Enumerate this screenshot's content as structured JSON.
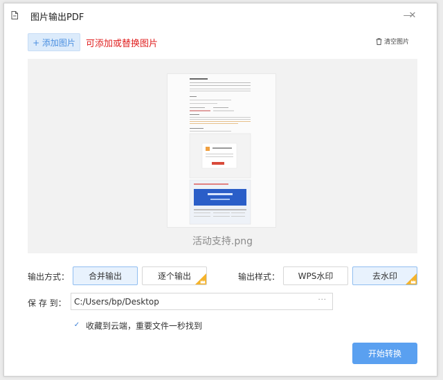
{
  "window": {
    "title": "图片输出PDF",
    "minimize_glyph": "—",
    "close_glyph": "✕"
  },
  "toolbar": {
    "add_label": "+ 添加图片",
    "hint": "可添加或替换图片",
    "clear_label": "清空图片"
  },
  "preview": {
    "filename": "活动支持.png"
  },
  "output_mode": {
    "label": "输出方式：",
    "options": [
      "合并输出",
      "逐个输出"
    ],
    "selected": "合并输出"
  },
  "output_style": {
    "label": "输出样式：",
    "options": [
      "WPS水印",
      "去水印"
    ],
    "selected": "去水印"
  },
  "save": {
    "label": "保 存 到：",
    "path": "C:/Users/bp/Desktop",
    "more": "···"
  },
  "cloud": {
    "checked": true,
    "check_glyph": "✓",
    "label": "收藏到云端，重要文件一秒找到"
  },
  "actions": {
    "start_label": "开始转换"
  },
  "colors": {
    "accent": "#5aa0f0",
    "hint_red": "#e02020",
    "vip_gold": "#f5b32b"
  }
}
